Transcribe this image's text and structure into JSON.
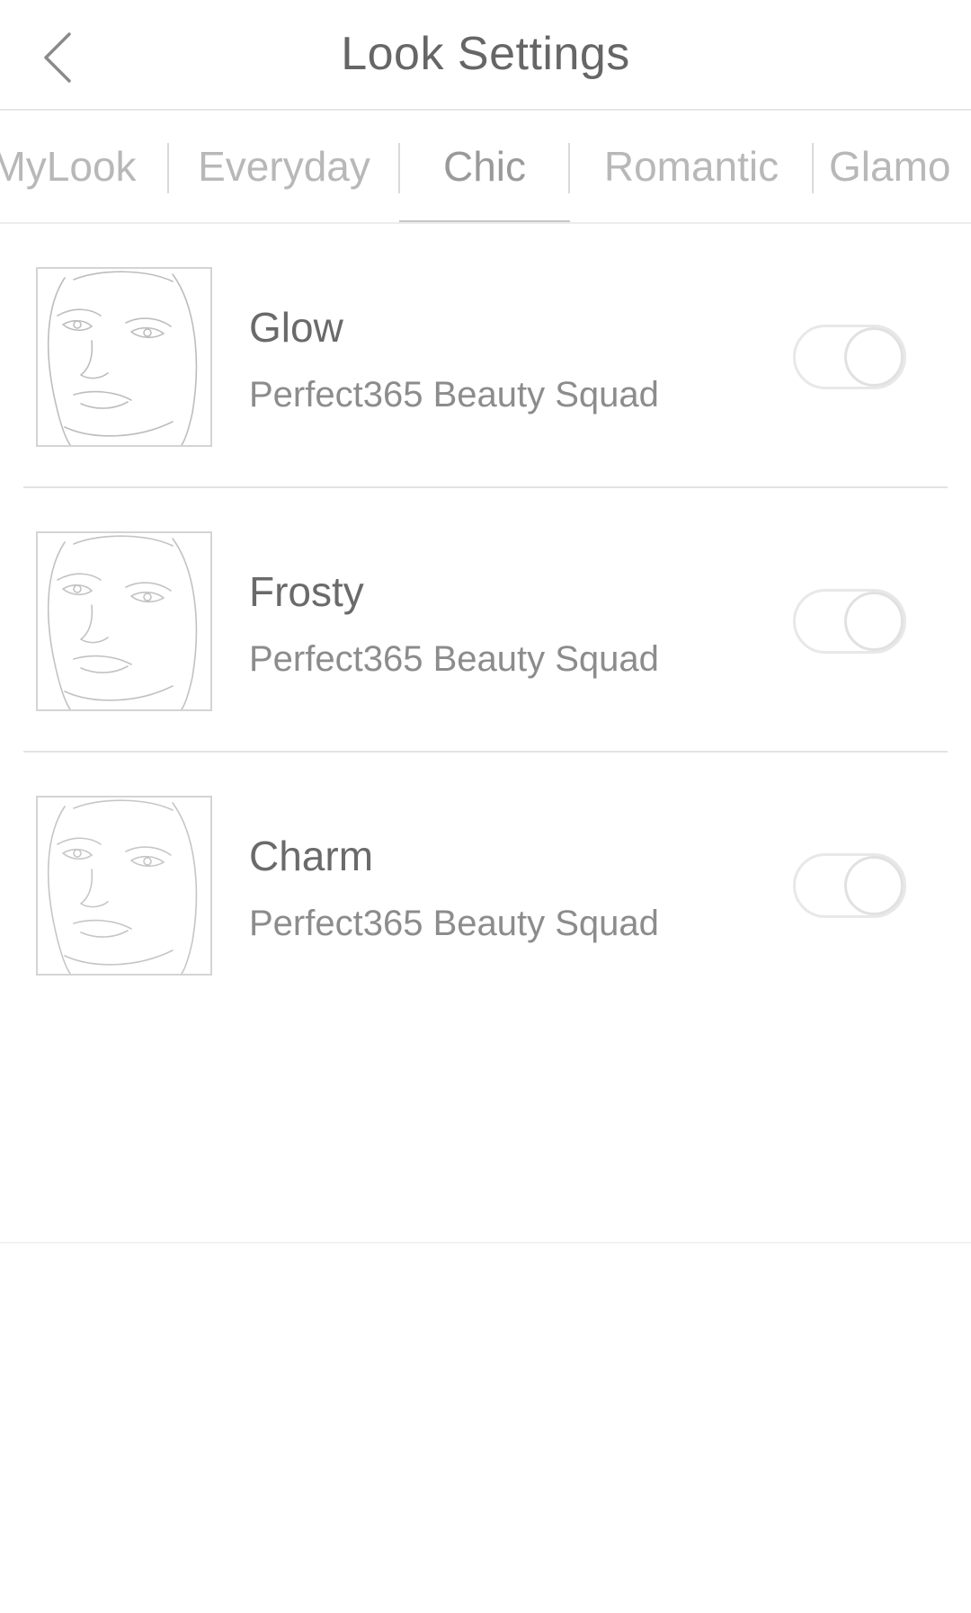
{
  "header": {
    "back_icon": "chevron-left-icon",
    "title": "Look Settings"
  },
  "tabs": {
    "items": [
      {
        "label": "MyLook"
      },
      {
        "label": "Everyday"
      },
      {
        "label": "Chic",
        "active": true
      },
      {
        "label": "Romantic"
      },
      {
        "label": "Glamo"
      }
    ]
  },
  "looks": [
    {
      "name": "Glow",
      "author": "Perfect365 Beauty Squad",
      "enabled": false,
      "thumb_icon": "face-sketch-icon"
    },
    {
      "name": "Frosty",
      "author": "Perfect365 Beauty Squad",
      "enabled": false,
      "thumb_icon": "face-sketch-icon"
    },
    {
      "name": "Charm",
      "author": "Perfect365 Beauty Squad",
      "enabled": false,
      "thumb_icon": "face-sketch-icon"
    }
  ],
  "colors": {
    "text_primary": "#666666",
    "text_secondary": "#8c8c8c",
    "tab_inactive": "#b8b8b8",
    "divider": "#e3e3e3"
  }
}
